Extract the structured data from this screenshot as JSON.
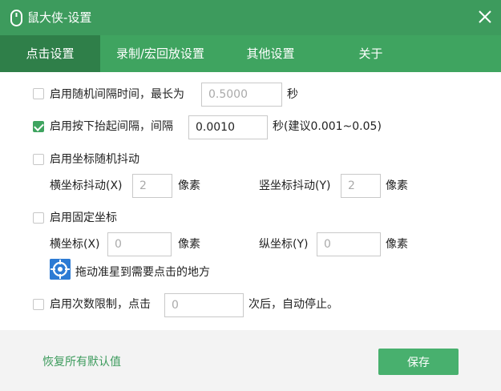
{
  "window": {
    "title": "鼠大侠-设置"
  },
  "tabs": [
    {
      "label": "点击设置",
      "active": true
    },
    {
      "label": "录制/宏回放设置",
      "active": false
    },
    {
      "label": "其他设置",
      "active": false
    },
    {
      "label": "关于",
      "active": false
    }
  ],
  "random_interval": {
    "enabled": false,
    "label": "启用随机间隔时间，最长为",
    "value": "0.5000",
    "unit": "秒"
  },
  "press_release": {
    "enabled": true,
    "label": "启用按下抬起间隔，间隔",
    "value": "0.0010",
    "unit": "秒(建议0.001~0.05)"
  },
  "jitter": {
    "enabled": false,
    "label": "启用坐标随机抖动",
    "x_label": "横坐标抖动(X)",
    "x_value": "2",
    "x_unit": "像素",
    "y_label": "竖坐标抖动(Y)",
    "y_value": "2",
    "y_unit": "像素"
  },
  "fixed_coord": {
    "enabled": false,
    "label": "启用固定坐标",
    "x_label": "横坐标(X)",
    "x_value": "0",
    "x_unit": "像素",
    "y_label": "纵坐标(Y)",
    "y_value": "0",
    "y_unit": "像素",
    "drag_hint": "拖动准星到需要点击的地方"
  },
  "count_limit": {
    "enabled": false,
    "label": "启用次数限制，点击",
    "value": "0",
    "suffix": "次后，自动停止。"
  },
  "footer": {
    "reset_label": "恢复所有默认值",
    "save_label": "保存"
  },
  "colors": {
    "titlebar": "#3d9b5d",
    "tabbar": "#3fa460",
    "tab_active": "#2f7f49",
    "accent": "#48b06e",
    "target_icon": "#2d7bd4"
  }
}
